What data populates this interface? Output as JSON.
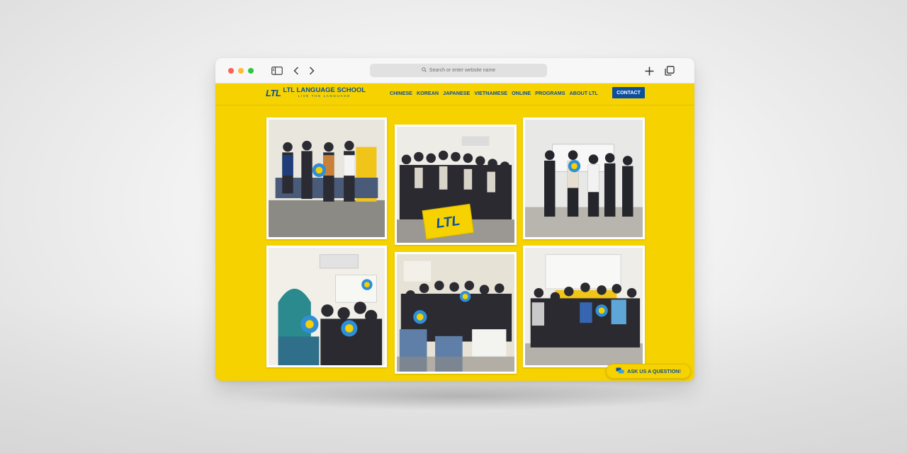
{
  "browser": {
    "address_placeholder": "Search or enter website name",
    "icons": {
      "sidebar": "sidebar-icon",
      "back": "chevron-left-icon",
      "forward": "chevron-right-icon",
      "new_tab": "plus-icon",
      "tabs": "tabs-overview-icon"
    }
  },
  "site": {
    "logo_mark": "LTL",
    "logo_name": "LTL LANGUAGE SCHOOL",
    "logo_tagline": "LIVE THE LANGUAGE",
    "nav": [
      "CHINESE",
      "KOREAN",
      "JAPANESE",
      "VIETNAMESE",
      "ONLINE",
      "PROGRAMS",
      "ABOUT LTL"
    ],
    "contact_label": "CONTACT",
    "ask_label": "ASK US A QUESTION!",
    "sign_text": "LTL",
    "colors": {
      "brand_yellow": "#f5d200",
      "brand_blue": "#0d4f9e",
      "frame_white": "#ffffff"
    },
    "photos": [
      "group-photo-1",
      "group-photo-2",
      "group-photo-3",
      "group-photo-4",
      "group-photo-5",
      "group-photo-6"
    ]
  }
}
